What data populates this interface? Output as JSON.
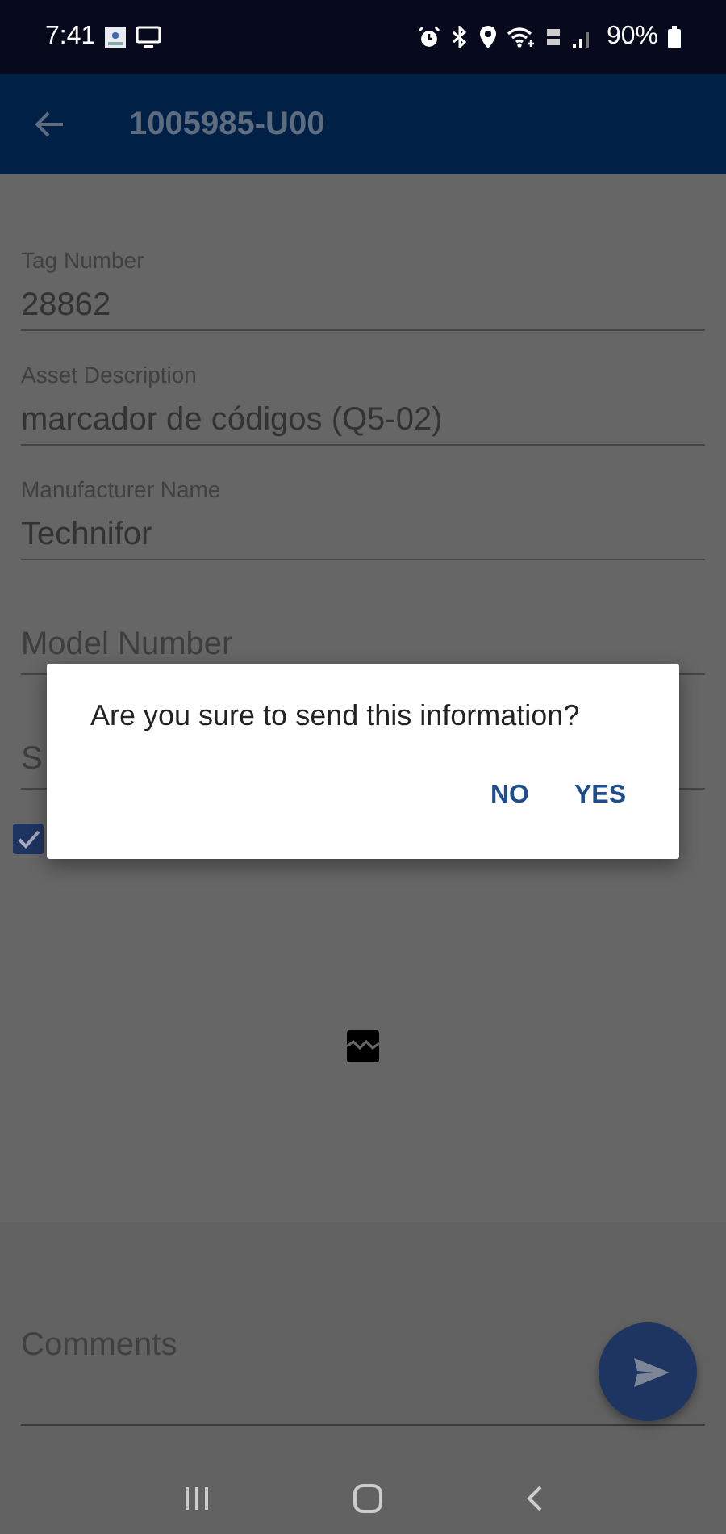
{
  "status_bar": {
    "time": "7:41",
    "battery": "90%"
  },
  "app_bar": {
    "title": "1005985-U00"
  },
  "fields": [
    {
      "kind": "filled",
      "label": "Tag Number",
      "value": "28862"
    },
    {
      "kind": "filled",
      "label": "Asset Description",
      "value": "marcador de códigos (Q5-02)"
    },
    {
      "kind": "filled",
      "label": "Manufacturer Name",
      "value": "Technifor"
    },
    {
      "kind": "empty",
      "placeholder": "Model Number"
    },
    {
      "kind": "empty",
      "placeholder": "S"
    }
  ],
  "checkbox": {
    "checked": true
  },
  "comments": {
    "placeholder": "Comments"
  },
  "dialog": {
    "message": "Are you sure to send this information?",
    "buttons": [
      "NO",
      "YES"
    ]
  }
}
